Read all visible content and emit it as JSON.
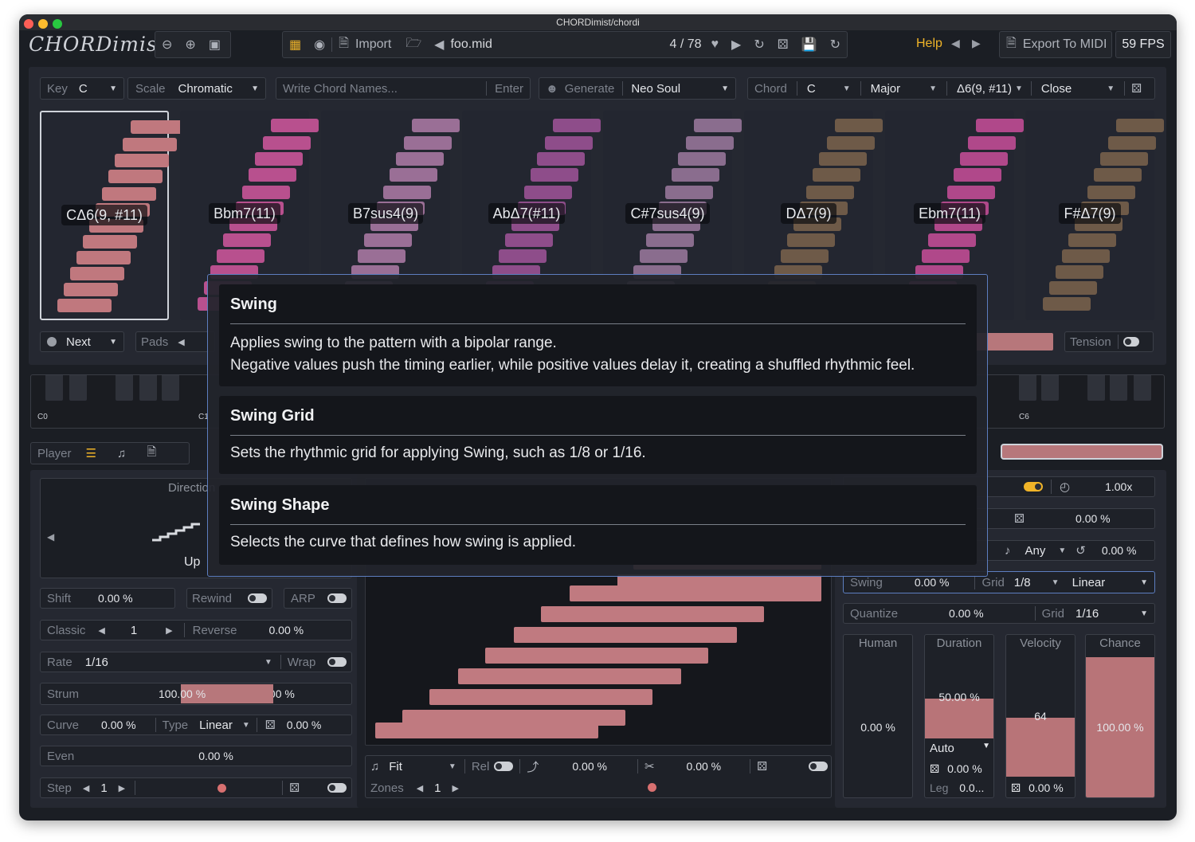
{
  "window": {
    "title": "CHORDimist/chordi"
  },
  "toolbar": {
    "logo": "CHORDimist",
    "import_label": "Import",
    "file_name": "foo.mid",
    "position": "4 / 78",
    "help_label": "Help",
    "export_label": "Export To MIDI",
    "fps": "59 FPS"
  },
  "controls": {
    "key_label": "Key",
    "key_value": "C",
    "scale_label": "Scale",
    "scale_value": "Chromatic",
    "chord_input_placeholder": "Write Chord Names...",
    "enter_label": "Enter",
    "generate_label": "Generate",
    "generate_style": "Neo Soul",
    "chord_label": "Chord",
    "chord_root": "C",
    "chord_quality": "Major",
    "chord_ext": "Δ6(9, #11)",
    "voicing": "Close"
  },
  "chords": [
    {
      "name": "CΔ6(9, #11)",
      "color": "#c0787e"
    },
    {
      "name": "Bbm7(11)",
      "color": "#b8508e"
    },
    {
      "name": "B7sus4(9)",
      "color": "#9a6f96"
    },
    {
      "name": "AbΔ7(#11)",
      "color": "#8e4d8a"
    },
    {
      "name": "C#7sus4(9)",
      "color": "#8a6d8e"
    },
    {
      "name": "DΔ7(9)",
      "color": "#6e5a48"
    },
    {
      "name": "Ebm7(11)",
      "color": "#b0488a"
    },
    {
      "name": "F#Δ7(9)",
      "color": "#6e5a48"
    }
  ],
  "row2": {
    "next_label": "Next",
    "pads_label": "Pads",
    "tension_label": "Tension"
  },
  "piano": {
    "c0": "C0",
    "c1": "C1",
    "c6": "C6"
  },
  "player": {
    "label": "Player",
    "direction_label": "Direction",
    "direction_value": "Up"
  },
  "left": {
    "shift_label": "Shift",
    "shift_value": "0.00 %",
    "rewind_label": "Rewind",
    "arp_label": "ARP",
    "classic_label": "Classic",
    "classic_value": "1",
    "reverse_label": "Reverse",
    "reverse_value": "0.00 %",
    "rate_label": "Rate",
    "rate_value": "1/16",
    "wrap_label": "Wrap",
    "strum_label": "Strum",
    "strum_value": "100.00 %",
    "strum_rand": "0.00 %",
    "strum_fill": 1.0,
    "curve_label": "Curve",
    "curve_value": "0.00 %",
    "type_label": "Type",
    "type_value": "Linear",
    "curve_rand": "0.00 %",
    "even_label": "Even",
    "even_value": "0.00 %",
    "step_label": "Step",
    "step_value": "1"
  },
  "center": {
    "fit_label": "Fit",
    "rel_label": "Rel",
    "offset_value": "0.00 %",
    "cut_value": "0.00 %",
    "zones_label": "Zones",
    "zones_value": "1"
  },
  "right": {
    "speed_value": "1.00x",
    "rand1_value": "0.00 %",
    "any_label": "Any",
    "rand2_value": "0.00 %",
    "swing_label": "Swing",
    "swing_value": "0.00 %",
    "grid_label": "Grid",
    "grid_value": "1/8",
    "shape_value": "Linear",
    "quantize_label": "Quantize",
    "quantize_value": "0.00 %",
    "qgrid_label": "Grid",
    "qgrid_value": "1/16",
    "human_label": "Human",
    "human_value": "0.00 %",
    "duration_label": "Duration",
    "duration_value": "50.00 %",
    "duration_fill": 0.5,
    "auto_label": "Auto",
    "duration_rand": "0.00 %",
    "leg_label": "Leg",
    "leg_value": "0.0...",
    "velocity_label": "Velocity",
    "velocity_value": "64",
    "velocity_fill": 0.5,
    "velocity_rand": "0.00 %",
    "chance_label": "Chance",
    "chance_value": "100.00 %",
    "chance_fill": 1.0
  },
  "tooltip": {
    "s1_title": "Swing",
    "s1_line1": "Applies swing to the pattern with a bipolar range.",
    "s1_line2": "Negative values push the timing earlier, while positive values delay it, creating a shuffled rhythmic feel.",
    "s2_title": "Swing Grid",
    "s2_line1": "Sets the rhythmic grid for applying Swing, such as 1/8 or 1/16.",
    "s3_title": "Swing Shape",
    "s3_line1": "Selects the curve that defines how swing is applied."
  },
  "colors": {
    "accent": "#f0b428",
    "note": "#c07a80",
    "tooltip_border": "#5d7ec0",
    "help": "#f0b428"
  }
}
